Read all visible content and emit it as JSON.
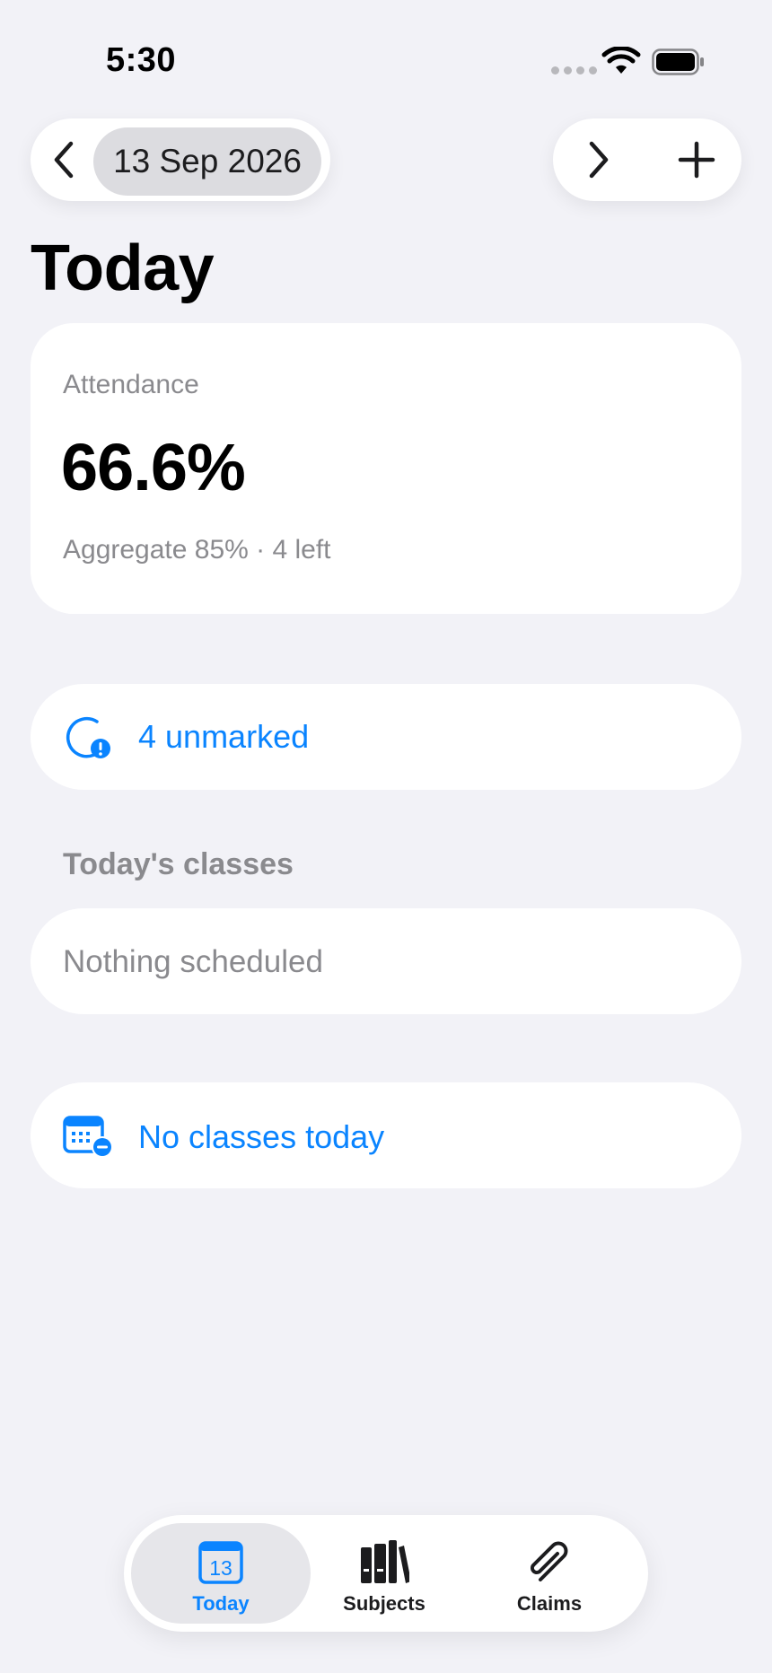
{
  "status_bar": {
    "time": "5:30"
  },
  "toolbar": {
    "date": "13 Sep 2026",
    "back_icon": "chevron-left-icon",
    "forward_icon": "chevron-right-icon",
    "add_icon": "plus-icon"
  },
  "page": {
    "title": "Today"
  },
  "attendance": {
    "label": "Attendance",
    "value": "66.6%",
    "subtitle": "Aggregate 85% · 4 left"
  },
  "unmarked": {
    "icon": "clock-badge-exclamation-icon",
    "text": "4 unmarked"
  },
  "classes_section": {
    "header": "Today's classes",
    "empty_text": "Nothing scheduled"
  },
  "no_classes": {
    "icon": "calendar-badge-minus-icon",
    "text": "No classes today"
  },
  "tabbar": {
    "tabs": [
      {
        "label": "Today",
        "icon": "calendar-13-icon",
        "selected": true,
        "day": "13"
      },
      {
        "label": "Subjects",
        "icon": "books-icon",
        "selected": false
      },
      {
        "label": "Claims",
        "icon": "paperclip-icon",
        "selected": false
      }
    ]
  },
  "colors": {
    "accent": "#0a84ff",
    "background": "#f2f2f7",
    "card": "#ffffff",
    "secondary_text": "#8a8a8e"
  }
}
